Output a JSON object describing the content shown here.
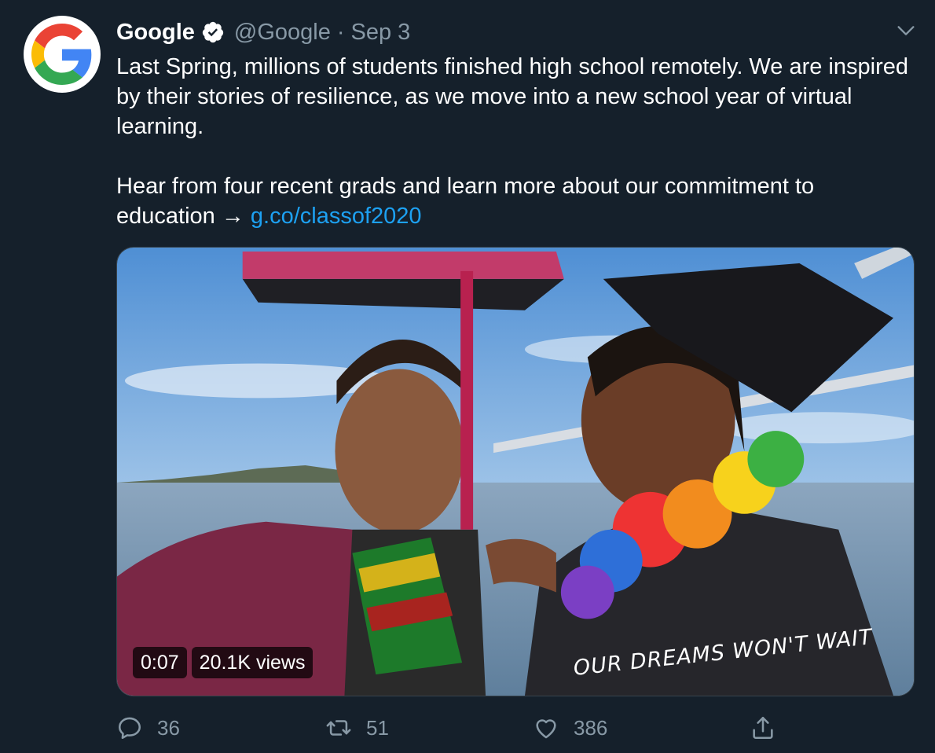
{
  "tweet": {
    "display_name": "Google",
    "handle": "@Google",
    "separator": "·",
    "date": "Sep 3",
    "verified": true,
    "avatar_icon": "google-g-logo",
    "text_paragraph_1": "Last Spring, millions of students finished high school remotely. We are inspired by their stories of resilience, as we move into a new school year of virtual learning.",
    "text_paragraph_2_prefix": "Hear from four recent grads and learn more about our commitment to education → ",
    "link_text": "g.co/classof2020"
  },
  "video": {
    "duration": "0:07",
    "views": "20.1K views",
    "watermark_text": "Our dreams won't wait"
  },
  "actions": {
    "reply_count": "36",
    "retweet_count": "51",
    "like_count": "386",
    "share_icon": "share-icon"
  },
  "colors": {
    "background": "#15202b",
    "text_primary": "#ffffff",
    "text_secondary": "#8899a6",
    "link": "#1da1f2"
  }
}
